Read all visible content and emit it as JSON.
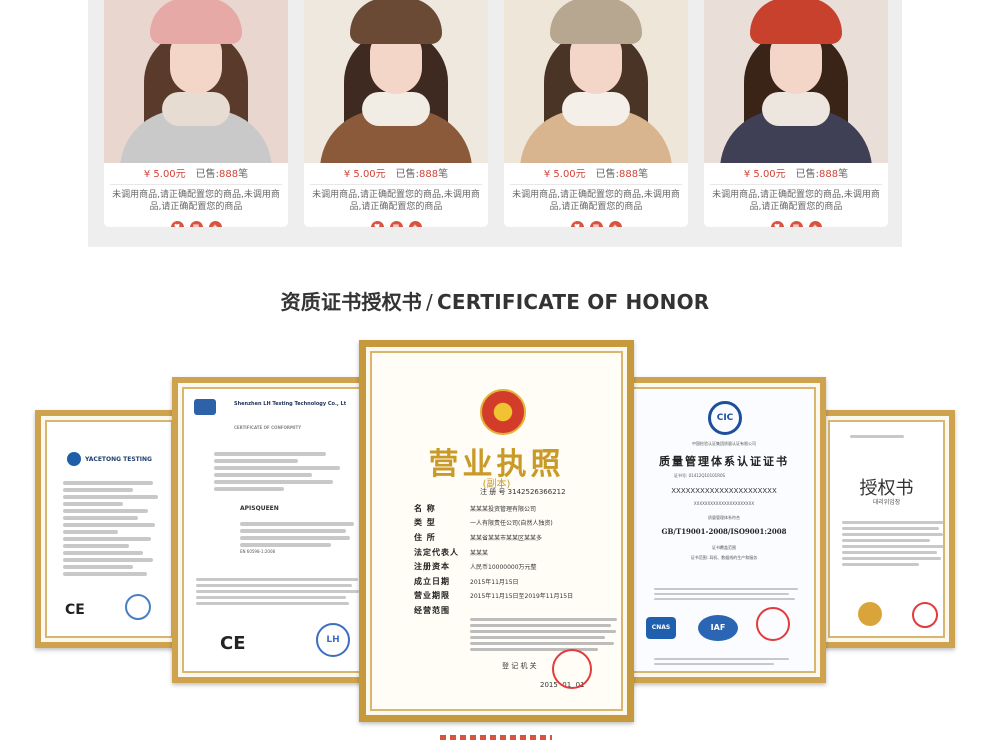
{
  "products": [
    {
      "price": "¥ 5.00元",
      "sold_label": "已售:",
      "sold_count": "888",
      "sold_unit": "笔",
      "desc": "未调用商品,请正确配置您的商品,未调用商品,请正确配置您的商品",
      "hat_color": "#e6a9a6",
      "coat_color": "#c9c9c9",
      "bg_color": "#e9d6cf"
    },
    {
      "price": "¥ 5.00元",
      "sold_label": "已售:",
      "sold_count": "888",
      "sold_unit": "笔",
      "desc": "未调用商品,请正确配置您的商品,未调用商品,请正确配置您的商品",
      "hat_color": "#6b4a35",
      "coat_color": "#8a5a3a",
      "bg_color": "#efe8de"
    },
    {
      "price": "¥ 5.00元",
      "sold_label": "已售:",
      "sold_count": "888",
      "sold_unit": "笔",
      "desc": "未调用商品,请正确配置您的商品,未调用商品,请正确配置您的商品",
      "hat_color": "#b7a690",
      "coat_color": "#d8b58e",
      "bg_color": "#efe6da"
    },
    {
      "price": "¥ 5.00元",
      "sold_label": "已售:",
      "sold_count": "888",
      "sold_unit": "笔",
      "desc": "未调用商品,请正确配置您的商品,未调用商品,请正确配置您的商品",
      "hat_color": "#c8412c",
      "coat_color": "#3f3f55",
      "bg_color": "#e9dfd8"
    }
  ],
  "card_icons": [
    "heart-icon",
    "cart-icon",
    "share-icon"
  ],
  "section": {
    "title_cn": "资质证书授权书",
    "separator": "/",
    "title_en": "CERTIFICATE OF HONOR"
  },
  "certificates": {
    "yacetong": {
      "brand": "YACETONG TESTING",
      "mark": "CE"
    },
    "lh": {
      "company": "Shenzhen LH Testing Technology Co., Lt",
      "heading": "CERTIFICATE OF CONFORMITY",
      "brand": "APISQUEEN",
      "standard": "EN 60598-1:2008",
      "mark": "CE",
      "stamp": "LH"
    },
    "license": {
      "title": "营业执照",
      "subtitle": "(副本)",
      "reg_no": "注 册 号 3142526366212",
      "rows": [
        {
          "label": "名    称",
          "value": "某某某投资管理有限公司"
        },
        {
          "label": "类    型",
          "value": "一人有限责任公司(自然人独资)"
        },
        {
          "label": "住    所",
          "value": "某某省某某市某某区某某多"
        },
        {
          "label": "法定代表人",
          "value": "某某某"
        },
        {
          "label": "注册资本",
          "value": "人民币10000000万元整"
        },
        {
          "label": "成立日期",
          "value": "2015年11月15日"
        },
        {
          "label": "营业期限",
          "value": "2015年11月15日至2019年11月15日"
        },
        {
          "label": "经营范围",
          "value": ""
        }
      ],
      "issuer": "登 记 机 关",
      "date": "2015  01  01"
    },
    "quality": {
      "org": "中国检验认证集团质量认证有限公司",
      "title": "质量管理体系认证证书",
      "cert_no": "证书号: 01412Q10101R0S",
      "name_line": "XXXXXXXXXXXXXXXXXXXXXX",
      "addr_line": "XXXXXXXXXXXXXXXXXXXXXX",
      "conform": "质量管理体系符合",
      "standard": "GB/T19001-2008/ISO9001:2008",
      "scope_title": "证书覆盖范围",
      "scope": "证书范围: 耳机、数据线的生产和服务",
      "logo": "CIC",
      "badges": [
        "CNAS",
        "IAF"
      ]
    },
    "auth": {
      "title": "授权书",
      "subtitle": "대리위임장"
    }
  }
}
